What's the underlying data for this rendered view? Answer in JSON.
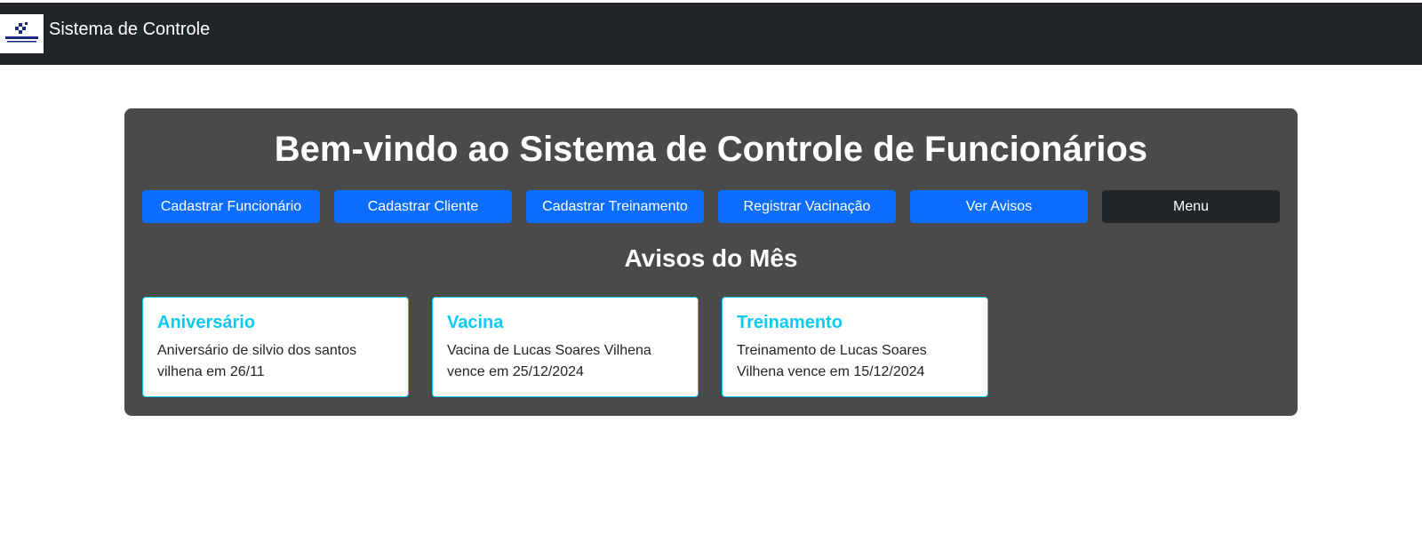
{
  "navbar": {
    "brand_title": "Sistema de Controle",
    "logo_name": "microdata-logo"
  },
  "main": {
    "title": "Bem-vindo ao Sistema de Controle de Funcionários",
    "buttons": [
      {
        "label": "Cadastrar Funcionário",
        "variant": "primary"
      },
      {
        "label": "Cadastrar Cliente",
        "variant": "primary"
      },
      {
        "label": "Cadastrar Treinamento",
        "variant": "primary"
      },
      {
        "label": "Registrar Vacinação",
        "variant": "primary"
      },
      {
        "label": "Ver Avisos",
        "variant": "primary"
      },
      {
        "label": "Menu",
        "variant": "dark"
      }
    ],
    "notices_title": "Avisos do Mês",
    "notices": [
      {
        "title": "Aniversário",
        "text": "Aniversário de silvio dos santos vilhena em 26/11"
      },
      {
        "title": "Vacina",
        "text": "Vacina de Lucas Soares Vilhena vence em 25/12/2024"
      },
      {
        "title": "Treinamento",
        "text": "Treinamento de Lucas Soares Vilhena vence em 15/12/2024"
      }
    ]
  },
  "colors": {
    "navbar_bg": "#212529",
    "panel_bg": "#4a4a4a",
    "primary": "#0d6efd",
    "dark": "#212529",
    "info": "#0dcaf0"
  }
}
